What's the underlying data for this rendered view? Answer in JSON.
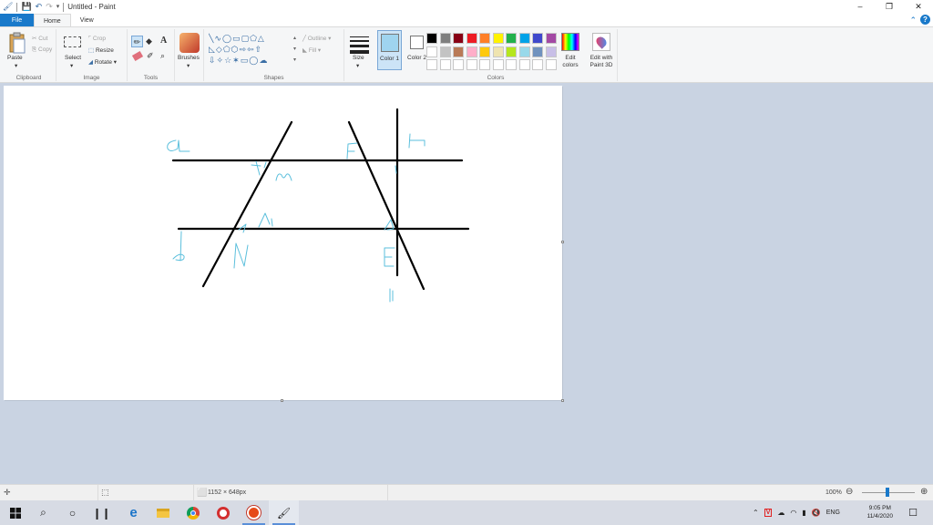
{
  "window": {
    "title": "Untitled - Paint",
    "minimize": "–",
    "maximize": "❐",
    "close": "✕"
  },
  "tabs": [
    {
      "label": "File"
    },
    {
      "label": "Home"
    },
    {
      "label": "View"
    }
  ],
  "ribbon": {
    "clipboard": {
      "label": "Clipboard",
      "paste": "Paste",
      "cut": "Cut",
      "copy": "Copy"
    },
    "image": {
      "label": "Image",
      "select": "Select",
      "crop": "Crop",
      "resize": "Resize",
      "rotate": "Rotate"
    },
    "tools": {
      "label": "Tools"
    },
    "brushes": {
      "label": "Brushes"
    },
    "shapes": {
      "label": "Shapes",
      "outline": "Outline",
      "fill": "Fill"
    },
    "size": {
      "label": "Size"
    },
    "colors": {
      "label": "Colors",
      "color1": "Color 1",
      "color2": "Color 2",
      "edit_colors": "Edit colors",
      "edit_3d": "Edit with Paint 3D",
      "color1_value": "#9fd4ef",
      "color2_value": "#ffffff",
      "palette_row1": [
        "#000000",
        "#7f7f7f",
        "#880015",
        "#ed1c24",
        "#ff7f27",
        "#fff200",
        "#22b14c",
        "#00a2e8",
        "#3f48cc",
        "#a349a4"
      ],
      "palette_row2": [
        "#ffffff",
        "#c3c3c3",
        "#b97a57",
        "#ffaec9",
        "#ffc90e",
        "#efe4b0",
        "#b5e61d",
        "#99d9ea",
        "#7092be",
        "#c8bfe7"
      ]
    }
  },
  "status": {
    "dimensions": "1152 × 648px",
    "zoom": "100%"
  },
  "taskbar": {
    "time": "9:05 PM",
    "date": "11/4/2020",
    "lang": "ENG"
  }
}
